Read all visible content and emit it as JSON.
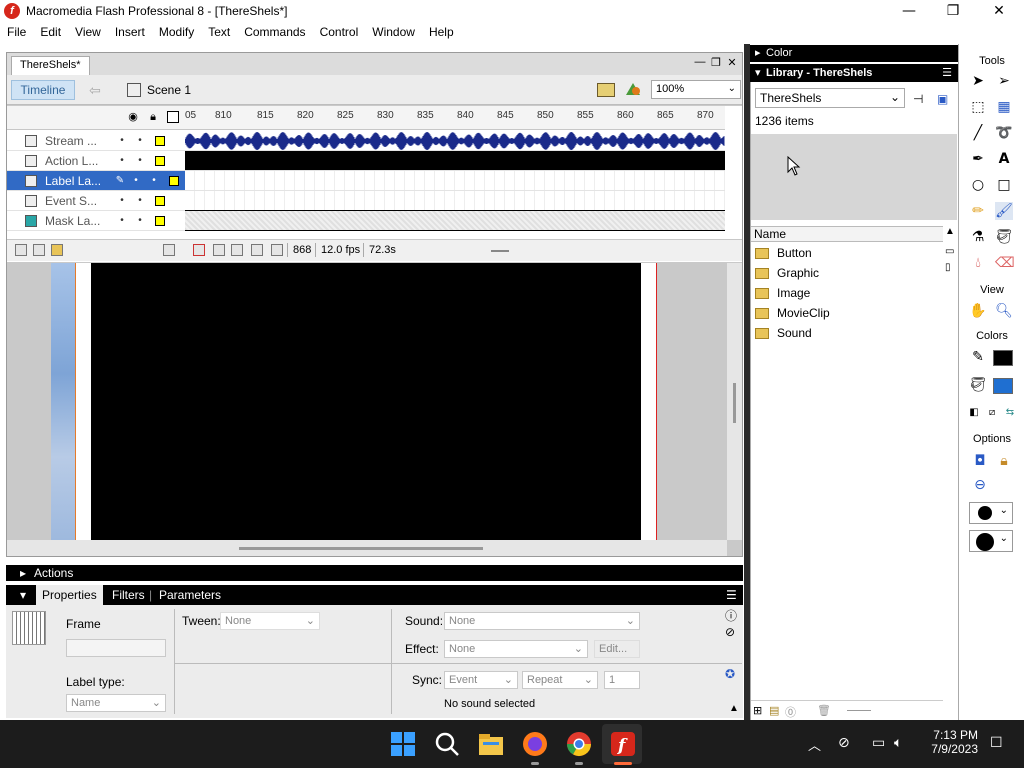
{
  "window": {
    "title": "Macromedia Flash Professional 8 - [ThereShels*]",
    "minimize": "—",
    "restore": "❐",
    "close": "✕"
  },
  "menubar": [
    "File",
    "Edit",
    "View",
    "Insert",
    "Modify",
    "Text",
    "Commands",
    "Control",
    "Window",
    "Help"
  ],
  "document": {
    "tab_label": "ThereShels*",
    "timeline_label": "Timeline",
    "scene_label": "Scene 1",
    "zoom": "100%"
  },
  "timeline": {
    "ruler_ticks": [
      "05",
      "810",
      "815",
      "820",
      "825",
      "830",
      "835",
      "840",
      "845",
      "850",
      "855",
      "860",
      "865",
      "870"
    ],
    "layers": [
      {
        "name": "Stream ...",
        "selected": false
      },
      {
        "name": "Action L...",
        "selected": false
      },
      {
        "name": "Label La...",
        "selected": true
      },
      {
        "name": "Event S...",
        "selected": false
      },
      {
        "name": "Mask La...",
        "selected": false
      }
    ],
    "current_frame": "868",
    "fps": "12.0 fps",
    "elapsed": "72.3s"
  },
  "panels": {
    "color_label": "Color",
    "library_label": "Library - ThereShels",
    "actions_label": "Actions"
  },
  "library": {
    "selected_doc": "ThereShels",
    "item_count": "1236 items",
    "column_name": "Name",
    "items": [
      "Button",
      "Graphic",
      "Image",
      "MovieClip",
      "Sound"
    ]
  },
  "tools": {
    "header": "Tools",
    "view_header": "View",
    "colors_header": "Colors",
    "options_header": "Options"
  },
  "properties": {
    "tabs": [
      "Properties",
      "Filters",
      "Parameters"
    ],
    "frame_label": "Frame",
    "tween_label": "Tween:",
    "tween_value": "None",
    "sound_label": "Sound:",
    "sound_value": "None",
    "effect_label": "Effect:",
    "effect_value": "None",
    "edit_label": "Edit...",
    "label_type_label": "Label type:",
    "label_type_value": "Name",
    "sync_label": "Sync:",
    "sync_value": "Event",
    "repeat_value": "Repeat",
    "repeat_count": "1",
    "status": "No sound selected"
  },
  "taskbar": {
    "time": "7:13 PM",
    "date": "7/9/2023"
  },
  "colors": {
    "accent": "#316ac5",
    "layer_color": "#ffff00",
    "waveform": "#1a2a8a"
  }
}
